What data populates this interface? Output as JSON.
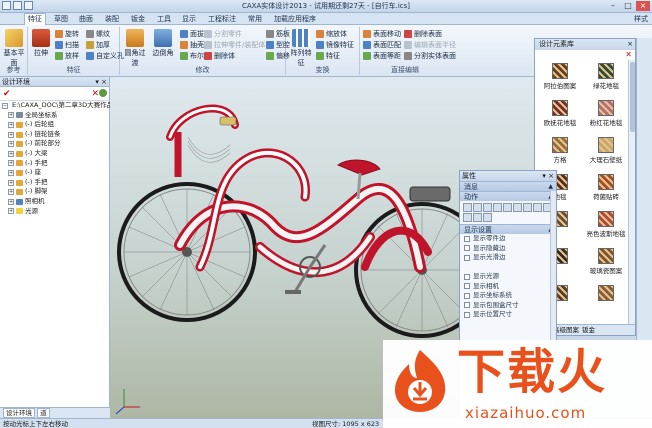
{
  "window": {
    "title": "CAXA实体设计2013 - 试用期还剩27天 - [自行车.ics]",
    "quick_access_count": 3
  },
  "tabs": {
    "items": [
      "特征",
      "草图",
      "曲面",
      "装配",
      "钣金",
      "工具",
      "显示",
      "工程标注",
      "常用",
      "加载应用程序"
    ],
    "active": "特征",
    "style_label": "样式"
  },
  "ribbon": {
    "groups": [
      {
        "name": "参考",
        "buttons": [
          "基本平面"
        ]
      },
      {
        "name": "特征",
        "buttons": [
          "拉伸",
          "旋转",
          "扫描",
          "放样",
          "螺纹",
          "加厚",
          "自定义孔"
        ]
      },
      {
        "name": "修改",
        "buttons": [
          "圆角过渡",
          "边倒角",
          "面拔模",
          "抽壳",
          "布尔",
          "分割零件",
          "拉伸零件/装配体",
          "删除体",
          "筋板",
          "型腔",
          "偏移"
        ]
      },
      {
        "name": "变换",
        "buttons": [
          "阵列特征",
          "缩放体",
          "镜像特征",
          "特征"
        ]
      },
      {
        "name": "直接编辑",
        "buttons": [
          "表面移动",
          "表面匹配",
          "表面等距",
          "删除表面",
          "编辑表面半径",
          "分割实体表面"
        ]
      }
    ]
  },
  "design_tree": {
    "title": "设计环境",
    "root": "E:\\CAXA_DOC\\第二章3D大赛作品",
    "items": [
      "全局坐标系",
      "(-) 后轮组",
      "(-) 链轮链条",
      "(-) 前轮部分",
      "(-) 大梁",
      "(-) 手把",
      "(-) 座",
      "(-) 手把",
      "(-) 脚架",
      "照相机",
      "光源"
    ],
    "bottom_tabs": [
      "设计环境",
      "道"
    ]
  },
  "properties": {
    "title": "属性",
    "sections": [
      "消息",
      "动作",
      "显示设置"
    ],
    "action_icon_count": 12,
    "display_options": [
      "显示零件边",
      "显示隐藏边",
      "显示光滑边",
      "",
      "显示光源",
      "显示相机",
      "显示坐标系统",
      "显示包围盒尺寸",
      "显示位置尺寸"
    ]
  },
  "library": {
    "title": "设计元素库",
    "items": [
      {
        "name": "阿拉伯图案",
        "color": "#6b3d1f"
      },
      {
        "name": "绿花地毯",
        "color": "#2f4a36"
      },
      {
        "name": "欧抚花地毯",
        "color": "#7a2c2c"
      },
      {
        "name": "粉红花地毯",
        "color": "#b56b7a"
      },
      {
        "name": "方格",
        "color": "#9c6b3e"
      },
      {
        "name": "大理石壁纸",
        "color": "#c9a46b"
      },
      {
        "name": "地毯",
        "color": "#5a2a1a"
      },
      {
        "name": "荷菌贴砖",
        "color": "#a84b2a"
      },
      {
        "name": "",
        "color": "#6d4b35"
      },
      {
        "name": "亮色波斯地毯",
        "color": "#b5453a"
      },
      {
        "name": "",
        "color": "#3a2a22"
      },
      {
        "name": "玻璃瓷图案",
        "color": "#7f5230"
      },
      {
        "name": "",
        "color": "#5c3a2a"
      },
      {
        "name": "",
        "color": "#8a5a3a"
      }
    ],
    "bottom_tabs": [
      "图案",
      "高级图案",
      "钣金"
    ]
  },
  "status": {
    "left": "按动光标上下左右移动",
    "center": "视图尺寸: 1095 x 623"
  },
  "watermark": {
    "brand": "下载火",
    "url": "xiazaihuo.com",
    "color": "#e8501c"
  },
  "colors": {
    "bike_red": "#c0142a",
    "bike_white": "#f4f4f4",
    "accent_blue": "#9fb5d2"
  }
}
